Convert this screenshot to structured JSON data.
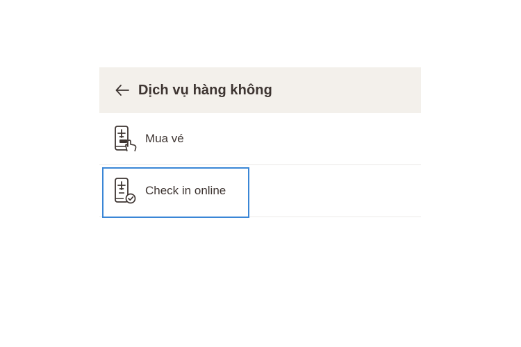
{
  "header": {
    "title": "Dịch vụ hàng không",
    "back_icon": "arrow-left-icon"
  },
  "items": [
    {
      "label": "Mua vé",
      "icon": "phone-plane-ticket-hand-icon"
    },
    {
      "label": "Check in online",
      "icon": "phone-plane-checkmark-icon"
    }
  ],
  "colors": {
    "header_bg": "#f3f0eb",
    "text": "#3d3431",
    "focus_border": "#3a86d6",
    "divider": "#ebe9e6"
  }
}
